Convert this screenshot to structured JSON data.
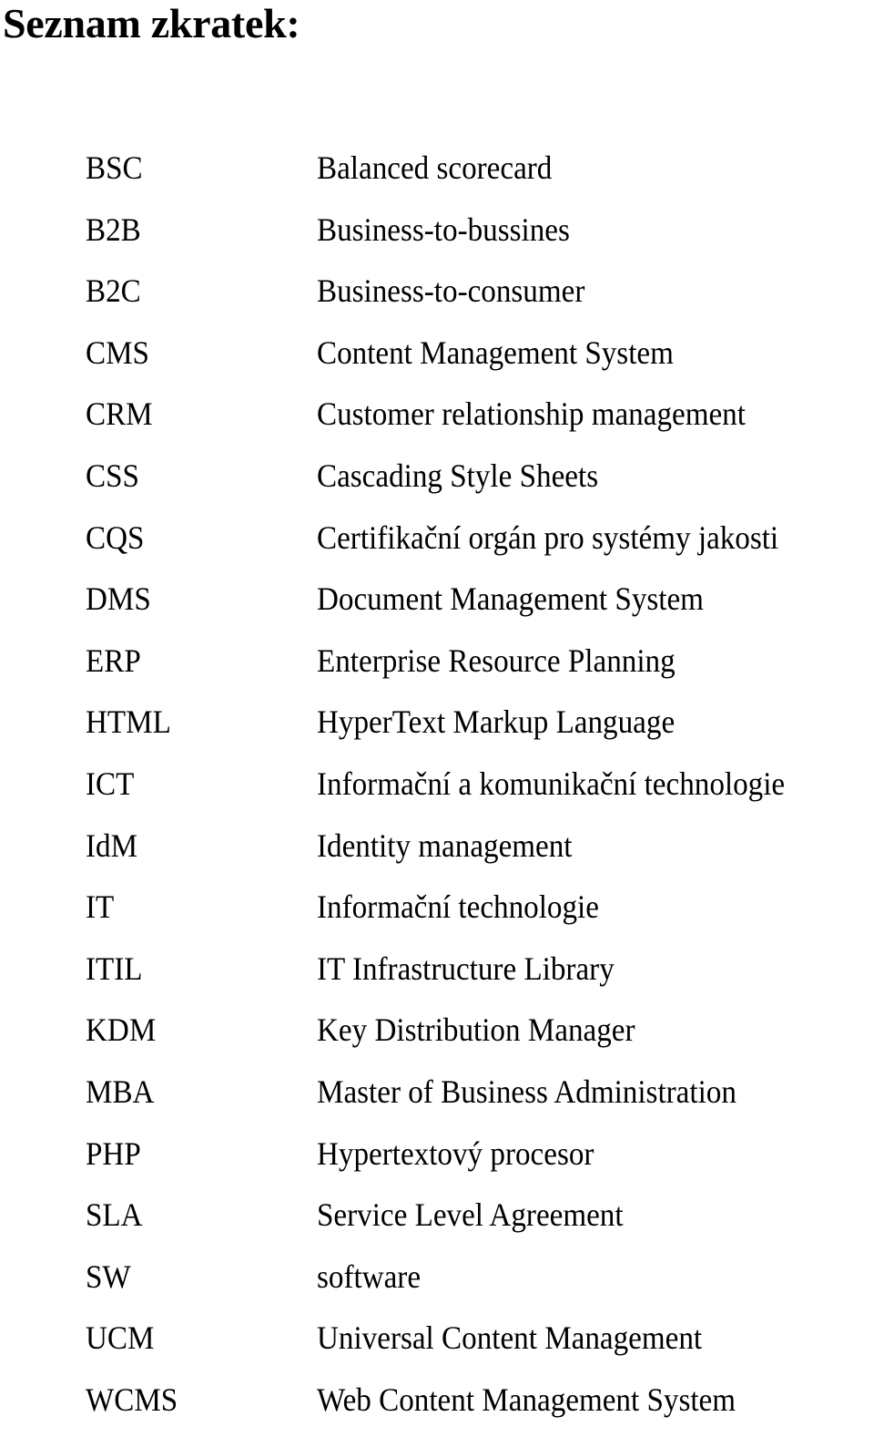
{
  "page": {
    "title": "Seznam zkratek:"
  },
  "abbreviations": [
    {
      "term": "BSC",
      "definition": "Balanced scorecard"
    },
    {
      "term": "B2B",
      "definition": "Business-to-bussines"
    },
    {
      "term": "B2C",
      "definition": "Business-to-consumer"
    },
    {
      "term": "CMS",
      "definition": "Content Management System"
    },
    {
      "term": "CRM",
      "definition": "Customer relationship management"
    },
    {
      "term": "CSS",
      "definition": "Cascading Style Sheets"
    },
    {
      "term": "CQS",
      "definition": "Certifikační orgán pro systémy jakosti"
    },
    {
      "term": "DMS",
      "definition": "Document Management System"
    },
    {
      "term": "ERP",
      "definition": "Enterprise Resource Planning"
    },
    {
      "term": "HTML",
      "definition": "HyperText Markup Language"
    },
    {
      "term": "ICT",
      "definition": "Informační a komunikační technologie"
    },
    {
      "term": "IdM",
      "definition": "Identity management"
    },
    {
      "term": "IT",
      "definition": "Informační technologie"
    },
    {
      "term": "ITIL",
      "definition": "IT Infrastructure Library"
    },
    {
      "term": "KDM",
      "definition": "Key Distribution Manager"
    },
    {
      "term": "MBA",
      "definition": "Master of Business Administration"
    },
    {
      "term": "PHP",
      "definition": "Hypertextový procesor"
    },
    {
      "term": "SLA",
      "definition": "Service Level Agreement"
    },
    {
      "term": "SW",
      "definition": "software"
    },
    {
      "term": "UCM",
      "definition": "Universal Content Management"
    },
    {
      "term": "WCMS",
      "definition": "Web Content Management System"
    }
  ]
}
